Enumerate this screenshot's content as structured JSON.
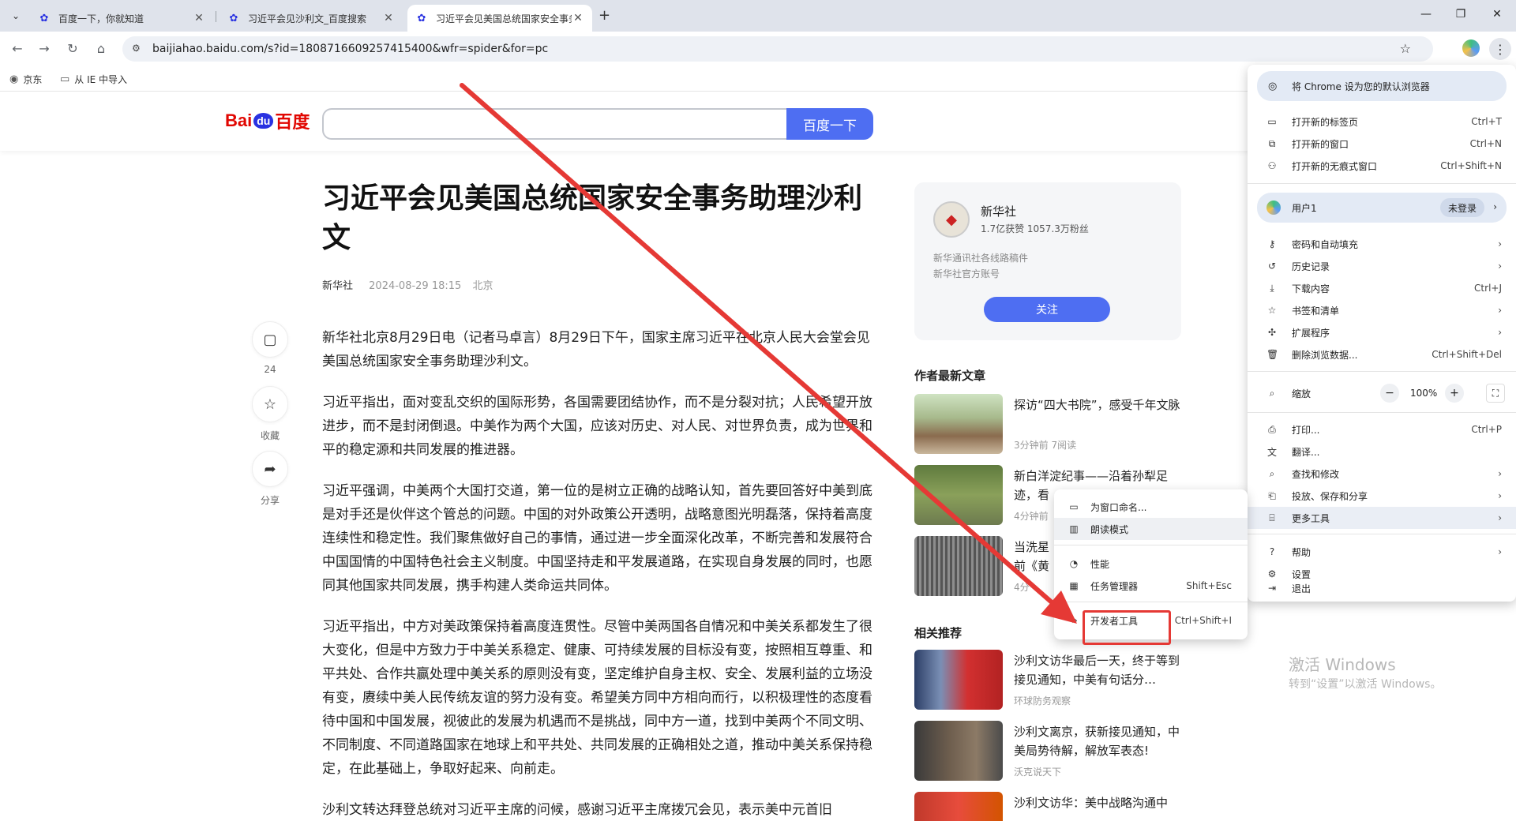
{
  "browser": {
    "tabs": [
      {
        "title": "百度一下，你就知道",
        "active": false
      },
      {
        "title": "习近平会见沙利文_百度搜索",
        "active": false
      },
      {
        "title": "习近平会见美国总统国家安全事务助理沙利文",
        "active": true
      }
    ],
    "address": "baijiahao.baidu.com/s?id=1808716609257415400&wfr=spider&for=pc",
    "bookmarks": [
      "京东",
      "从 IE 中导入"
    ]
  },
  "baidu": {
    "logo_bai": "Bai",
    "logo_du": "du",
    "logo_bd": "百度",
    "search_button": "百度一下",
    "search_value": ""
  },
  "article": {
    "title": "习近平会见美国总统国家安全事务助理沙利文",
    "source": "新华社",
    "date": "2024-08-29 18:15",
    "location": "北京",
    "paragraphs": [
      "新华社北京8月29日电（记者马卓言）8月29日下午，国家主席习近平在北京人民大会堂会见美国总统国家安全事务助理沙利文。",
      "习近平指出，面对变乱交织的国际形势，各国需要团结协作，而不是分裂对抗；人民希望开放进步，而不是封闭倒退。中美作为两个大国，应该对历史、对人民、对世界负责，成为世界和平的稳定源和共同发展的推进器。",
      "习近平强调，中美两个大国打交道，第一位的是树立正确的战略认知，首先要回答好中美到底是对手还是伙伴这个管总的问题。中国的对外政策公开透明，战略意图光明磊落，保持着高度连续性和稳定性。我们聚焦做好自己的事情，通过进一步全面深化改革，不断完善和发展符合中国国情的中国特色社会主义制度。中国坚持走和平发展道路，在实现自身发展的同时，也愿同其他国家共同发展，携手构建人类命运共同体。",
      "习近平指出，中方对美政策保持着高度连贯性。尽管中美两国各自情况和中美关系都发生了很大变化，但是中方致力于中美关系稳定、健康、可持续发展的目标没有变，按照相互尊重、和平共处、合作共赢处理中美关系的原则没有变，坚定维护自身主权、安全、发展利益的立场没有变，赓续中美人民传统友谊的努力没有变。希望美方同中方相向而行，以积极理性的态度看待中国和中国发展，视彼此的发展为机遇而不是挑战，同中方一道，找到中美两个不同文明、不同制度、不同道路国家在地球上和平共处、共同发展的正确相处之道，推动中美关系保持稳定，在此基础上，争取好起来、向前走。",
      "沙利文转达拜登总统对习近平主席的问候，感谢习近平主席拨冗会见，表示美中元首旧"
    ]
  },
  "side_actions": {
    "comment_count": "24",
    "favorite": "收藏",
    "share": "分享"
  },
  "author": {
    "name": "新华社",
    "stats": "1.7亿获赞 1057.3万粉丝",
    "desc1": "新华通讯社各线路稿件",
    "desc2": "新华社官方账号",
    "follow": "关注"
  },
  "latest": {
    "heading": "作者最新文章",
    "items": [
      {
        "title": "探访“四大书院”，感受千年文脉",
        "meta": "3分钟前   7阅读"
      },
      {
        "title": "新白洋淀纪事——沿着孙犁足迹，看",
        "meta": "4分钟前"
      },
      {
        "title": "当洗星",
        "title2": "前《黄",
        "meta": "4分"
      }
    ]
  },
  "related": {
    "heading": "相关推荐",
    "items": [
      {
        "title": "沙利文访华最后一天，终于等到接见通知，中美有句话分…",
        "meta": "环球防务观察"
      },
      {
        "title": "沙利文离京，获新接见通知，中美局势待解，解放军表态!",
        "meta": "沃克说天下"
      },
      {
        "title": "沙利文访华：美中战略沟通中",
        "meta": ""
      }
    ]
  },
  "watermark": {
    "line1": "激活 Windows",
    "line2": "转到“设置”以激活 Windows。"
  },
  "chrome_menu": {
    "default_browser": "将 Chrome 设为您的默认浏览器",
    "new_tab": "打开新的标签页",
    "new_tab_sc": "Ctrl+T",
    "new_window": "打开新的窗口",
    "new_window_sc": "Ctrl+N",
    "incognito": "打开新的无痕式窗口",
    "incognito_sc": "Ctrl+Shift+N",
    "user": "用户1",
    "user_badge": "未登录",
    "passwords": "密码和自动填充",
    "history": "历史记录",
    "downloads": "下载内容",
    "downloads_sc": "Ctrl+J",
    "bookmarks": "书签和清单",
    "extensions": "扩展程序",
    "clear_data": "删除浏览数据...",
    "clear_data_sc": "Ctrl+Shift+Del",
    "zoom": "缩放",
    "zoom_minus": "−",
    "zoom_value": "100%",
    "zoom_plus": "+",
    "print": "打印...",
    "print_sc": "Ctrl+P",
    "translate": "翻译...",
    "find_edit": "查找和修改",
    "cast_save": "投放、保存和分享",
    "more_tools": "更多工具",
    "help": "帮助",
    "settings": "设置",
    "exit": "退出"
  },
  "more_tools_menu": {
    "name_window": "为窗口命名...",
    "reading_mode": "朗读模式",
    "performance": "性能",
    "task_manager": "任务管理器",
    "task_manager_sc": "Shift+Esc",
    "devtools": "开发者工具",
    "devtools_sc": "Ctrl+Shift+I"
  },
  "colors": {
    "accent_blue": "#4e6ef2",
    "highlight_red": "#e53935",
    "baidu_red": "#e10601"
  }
}
